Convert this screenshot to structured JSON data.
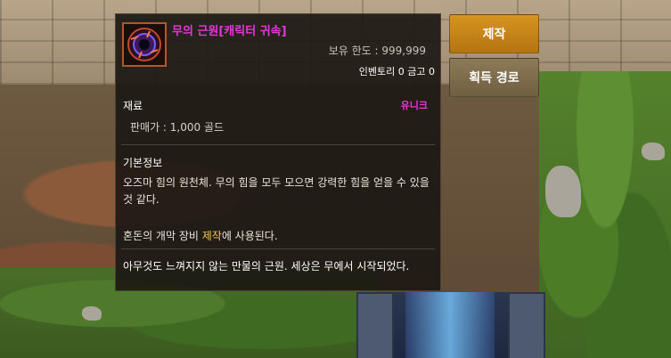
{
  "item": {
    "name": "무의 근원[캐릭터 귀속]",
    "limit_label": "보유 한도 : 999,999",
    "inventory_label": "인벤토리 0 금고 0",
    "category": "재료",
    "rarity": "유니크",
    "sell_price": "판매가 : 1,000 골드",
    "info_heading": "기본정보",
    "description": "오즈마 힘의 원천체. 무의 힘을 모두 모으면 강력한 힘을 얻을 수 있을 것 같다.",
    "usage_prefix": "혼돈의 개막 장비 ",
    "usage_highlight": "제작",
    "usage_suffix": "에 사용된다.",
    "flavor": "아무것도 느껴지지 않는 만물의 근원. 세상은 무에서 시작되었다."
  },
  "buttons": {
    "craft_label": "제작",
    "route_label": "획득 경로"
  },
  "colors": {
    "rarity_unique": "#e33ad6",
    "highlight": "#f2c94c",
    "craft_button": "#c98516",
    "route_button": "#7d6b4b"
  },
  "icons": {
    "item": "void-orb-icon"
  }
}
